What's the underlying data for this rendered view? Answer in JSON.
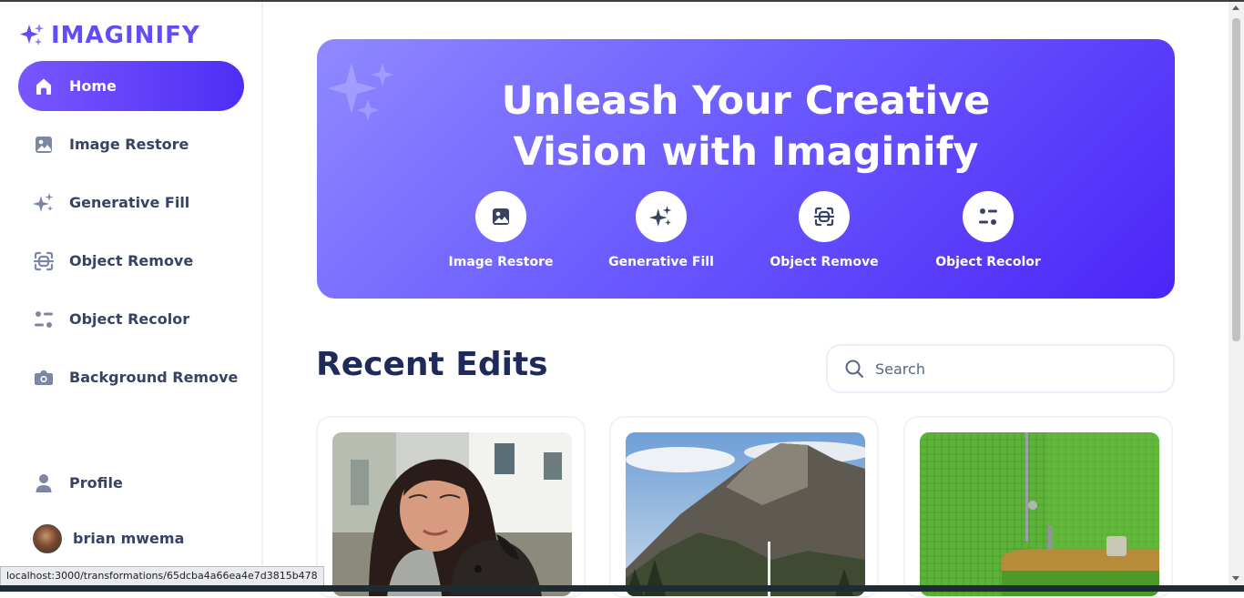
{
  "app": {
    "name": "IMAGINIFY",
    "brand_color": "#624cf5"
  },
  "sidebar": {
    "items": [
      {
        "label": "Home",
        "icon": "home-icon",
        "active": true
      },
      {
        "label": "Image Restore",
        "icon": "image-icon",
        "active": false
      },
      {
        "label": "Generative Fill",
        "icon": "stars-icon",
        "active": false
      },
      {
        "label": "Object Remove",
        "icon": "scan-icon",
        "active": false
      },
      {
        "label": "Object Recolor",
        "icon": "filter-icon",
        "active": false
      },
      {
        "label": "Background Remove",
        "icon": "camera-icon",
        "active": false
      }
    ],
    "profile_label": "Profile",
    "user_name": "brian mwema"
  },
  "hero": {
    "title_line1": "Unleash Your Creative",
    "title_line2": "Vision with Imaginify",
    "features": [
      {
        "label": "Image Restore",
        "icon": "image-icon"
      },
      {
        "label": "Generative Fill",
        "icon": "stars-icon"
      },
      {
        "label": "Object Remove",
        "icon": "scan-icon"
      },
      {
        "label": "Object Recolor",
        "icon": "filter-icon"
      }
    ]
  },
  "recent": {
    "title": "Recent Edits",
    "search_placeholder": "Search",
    "cards": [
      {
        "image": "woman-with-dog-photo"
      },
      {
        "image": "mountain-cliff-photo"
      },
      {
        "image": "green-tiled-bathroom-photo"
      }
    ]
  },
  "status_bar": {
    "url": "localhost:3000/transformations/65dcba4a66ea4e7d3815b478"
  }
}
